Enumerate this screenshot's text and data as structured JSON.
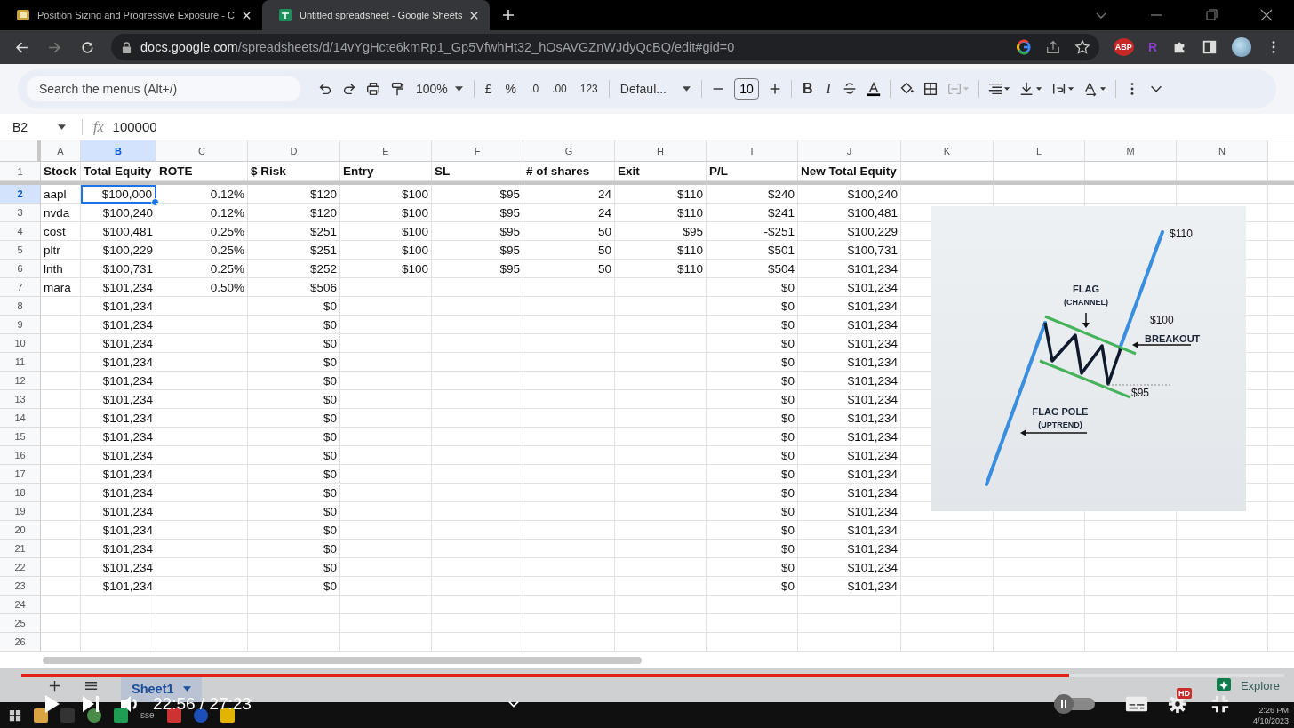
{
  "browser": {
    "tabs": [
      {
        "title": "Position Sizing and Progressive Exposure - C",
        "selected": false
      },
      {
        "title": "Untitled spreadsheet - Google Sheets",
        "selected": true
      }
    ],
    "url_domain": "docs.google.com",
    "url_path": "/spreadsheets/d/14vYgHcte6kmRp1_Gp5VfwhHt32_hOsAVGZnWJdyQcBQ/edit#gid=0",
    "extensions": [
      "ABP",
      "R"
    ]
  },
  "toolbar": {
    "search_placeholder": "Search the menus (Alt+/)",
    "zoom": "100%",
    "currency": "£",
    "percent": "%",
    "decrease_decimals": ".0",
    "increase_decimals": ".00",
    "number_format": "123",
    "font": "Defaul...",
    "font_size": "10",
    "bold": "B",
    "italic": "I"
  },
  "formula_bar": {
    "cell_ref": "B2",
    "fx": "fx",
    "formula": "100000"
  },
  "columns": [
    {
      "letter": "A",
      "selected": false
    },
    {
      "letter": "B",
      "selected": true
    },
    {
      "letter": "C",
      "selected": false
    },
    {
      "letter": "D",
      "selected": false
    },
    {
      "letter": "E",
      "selected": false
    },
    {
      "letter": "F",
      "selected": false
    },
    {
      "letter": "G",
      "selected": false
    },
    {
      "letter": "H",
      "selected": false
    },
    {
      "letter": "I",
      "selected": false
    },
    {
      "letter": "J",
      "selected": false
    },
    {
      "letter": "K",
      "selected": false
    },
    {
      "letter": "L",
      "selected": false
    },
    {
      "letter": "M",
      "selected": false
    },
    {
      "letter": "N",
      "selected": false
    }
  ],
  "rows": [
    {
      "number": "1",
      "kind": "header",
      "selected": false,
      "cells": {
        "A": "Stock",
        "B": "Total Equity",
        "C": "ROTE",
        "D": "$ Risk",
        "E": "Entry",
        "F": "SL",
        "G": "# of shares",
        "H": "Exit",
        "I": "P/L",
        "J": "New Total Equity"
      }
    },
    {
      "number": "2",
      "kind": "data",
      "selected": true,
      "cells": {
        "A": "aapl",
        "B": "$100,000",
        "C": "0.12%",
        "D": "$120",
        "E": "$100",
        "F": "$95",
        "G": "24",
        "H": "$110",
        "I": "$240",
        "J": "$100,240"
      }
    },
    {
      "number": "3",
      "kind": "data",
      "selected": false,
      "cells": {
        "A": "nvda",
        "B": "$100,240",
        "C": "0.12%",
        "D": "$120",
        "E": "$100",
        "F": "$95",
        "G": "24",
        "H": "$110",
        "I": "$241",
        "J": "$100,481"
      }
    },
    {
      "number": "4",
      "kind": "data",
      "selected": false,
      "cells": {
        "A": "cost",
        "B": "$100,481",
        "C": "0.25%",
        "D": "$251",
        "E": "$100",
        "F": "$95",
        "G": "50",
        "H": "$95",
        "I": "-$251",
        "J": "$100,229"
      }
    },
    {
      "number": "5",
      "kind": "data",
      "selected": false,
      "cells": {
        "A": "pltr",
        "B": "$100,229",
        "C": "0.25%",
        "D": "$251",
        "E": "$100",
        "F": "$95",
        "G": "50",
        "H": "$110",
        "I": "$501",
        "J": "$100,731"
      }
    },
    {
      "number": "6",
      "kind": "data",
      "selected": false,
      "cells": {
        "A": "lnth",
        "B": "$100,731",
        "C": "0.25%",
        "D": "$252",
        "E": "$100",
        "F": "$95",
        "G": "50",
        "H": "$110",
        "I": "$504",
        "J": "$101,234"
      }
    },
    {
      "number": "7",
      "kind": "data",
      "selected": false,
      "cells": {
        "A": "mara",
        "B": "$101,234",
        "C": "0.50%",
        "D": "$506",
        "I": "$0",
        "J": "$101,234"
      }
    },
    {
      "number": "8",
      "kind": "data",
      "selected": false,
      "cells": {
        "B": "$101,234",
        "D": "$0",
        "I": "$0",
        "J": "$101,234"
      }
    },
    {
      "number": "9",
      "kind": "data",
      "selected": false,
      "cells": {
        "B": "$101,234",
        "D": "$0",
        "I": "$0",
        "J": "$101,234"
      }
    },
    {
      "number": "10",
      "kind": "data",
      "selected": false,
      "cells": {
        "B": "$101,234",
        "D": "$0",
        "I": "$0",
        "J": "$101,234"
      }
    },
    {
      "number": "11",
      "kind": "data",
      "selected": false,
      "cells": {
        "B": "$101,234",
        "D": "$0",
        "I": "$0",
        "J": "$101,234"
      }
    },
    {
      "number": "12",
      "kind": "data",
      "selected": false,
      "cells": {
        "B": "$101,234",
        "D": "$0",
        "I": "$0",
        "J": "$101,234"
      }
    },
    {
      "number": "13",
      "kind": "data",
      "selected": false,
      "cells": {
        "B": "$101,234",
        "D": "$0",
        "I": "$0",
        "J": "$101,234"
      }
    },
    {
      "number": "14",
      "kind": "data",
      "selected": false,
      "cells": {
        "B": "$101,234",
        "D": "$0",
        "I": "$0",
        "J": "$101,234"
      }
    },
    {
      "number": "15",
      "kind": "data",
      "selected": false,
      "cells": {
        "B": "$101,234",
        "D": "$0",
        "I": "$0",
        "J": "$101,234"
      }
    },
    {
      "number": "16",
      "kind": "data",
      "selected": false,
      "cells": {
        "B": "$101,234",
        "D": "$0",
        "I": "$0",
        "J": "$101,234"
      }
    },
    {
      "number": "17",
      "kind": "data",
      "selected": false,
      "cells": {
        "B": "$101,234",
        "D": "$0",
        "I": "$0",
        "J": "$101,234"
      }
    },
    {
      "number": "18",
      "kind": "data",
      "selected": false,
      "cells": {
        "B": "$101,234",
        "D": "$0",
        "I": "$0",
        "J": "$101,234"
      }
    },
    {
      "number": "19",
      "kind": "data",
      "selected": false,
      "cells": {
        "B": "$101,234",
        "D": "$0",
        "I": "$0",
        "J": "$101,234"
      }
    },
    {
      "number": "20",
      "kind": "data",
      "selected": false,
      "cells": {
        "B": "$101,234",
        "D": "$0",
        "I": "$0",
        "J": "$101,234"
      }
    },
    {
      "number": "21",
      "kind": "data",
      "selected": false,
      "cells": {
        "B": "$101,234",
        "D": "$0",
        "I": "$0",
        "J": "$101,234"
      }
    },
    {
      "number": "22",
      "kind": "data",
      "selected": false,
      "cells": {
        "B": "$101,234",
        "D": "$0",
        "I": "$0",
        "J": "$101,234"
      }
    },
    {
      "number": "23",
      "kind": "data",
      "selected": false,
      "cells": {
        "B": "$101,234",
        "D": "$0",
        "I": "$0",
        "J": "$101,234"
      }
    },
    {
      "number": "24",
      "kind": "data",
      "selected": false,
      "cells": {}
    },
    {
      "number": "25",
      "kind": "data",
      "selected": false,
      "cells": {}
    },
    {
      "number": "26",
      "kind": "data",
      "selected": false,
      "cells": {}
    }
  ],
  "flag_image": {
    "high": "$110",
    "flag": "FLAG",
    "channel": "(CHANNEL)",
    "mid": "$100",
    "breakout": "BREAKOUT",
    "low": "$95",
    "pole": "FLAG POLE",
    "uptrend": "(UPTREND)"
  },
  "sheet_tabs": [
    {
      "name": "Sheet1",
      "selected": true
    }
  ],
  "explore": "Explore",
  "video": {
    "time": "22:56 / 27:23",
    "level": 0.83,
    "quality": "HD"
  },
  "taskbar": {
    "app_label": "sse",
    "time": "2:26 PM",
    "date": "4/10/2023"
  }
}
